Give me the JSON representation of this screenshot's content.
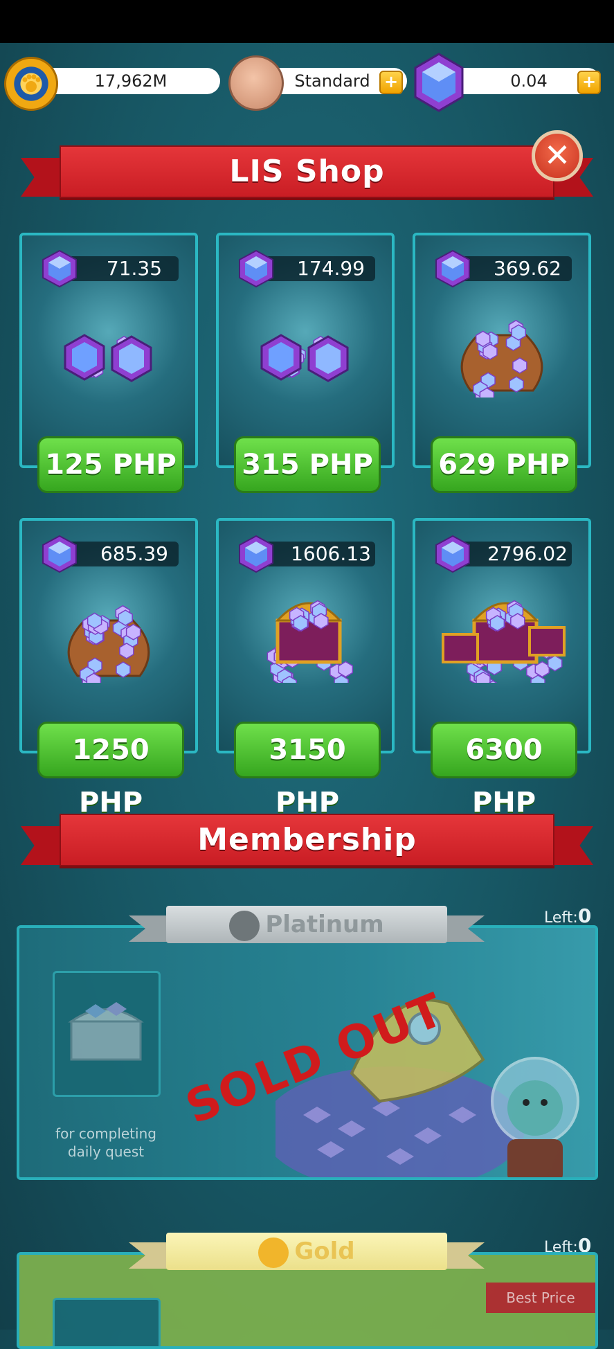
{
  "topbar": {
    "coins_value": "17,962M",
    "membership_label": "Standard",
    "gems_value": "0.04"
  },
  "shop": {
    "title": "LIS  Shop",
    "items": [
      {
        "amount": "71.35",
        "price": "125 PHP",
        "art": "small-gem-pile-icon"
      },
      {
        "amount": "174.99",
        "price": "315 PHP",
        "art": "gem-pile-icon"
      },
      {
        "amount": "369.62",
        "price": "629 PHP",
        "art": "gem-pouch-icon"
      },
      {
        "amount": "685.39",
        "price": "1250 PHP",
        "art": "gem-sack-icon"
      },
      {
        "amount": "1606.13",
        "price": "3150 PHP",
        "art": "gem-chest-icon"
      },
      {
        "amount": "2796.02",
        "price": "6300 PHP",
        "art": "gem-chests-icon"
      }
    ]
  },
  "membership": {
    "title": "Membership",
    "platinum": {
      "name": "Platinum",
      "left_label": "Left:",
      "left_count": "0",
      "caption": "for completing daily quest",
      "sold_out": "SOLD OUT"
    },
    "gold": {
      "name": "Gold",
      "left_label": "Left:",
      "left_count": "0",
      "badge": "Best Price"
    }
  },
  "colors": {
    "ribbon_red": "#d9272e",
    "price_green": "#4cc22d",
    "card_border": "#2bb8c3",
    "background": "#175663"
  }
}
